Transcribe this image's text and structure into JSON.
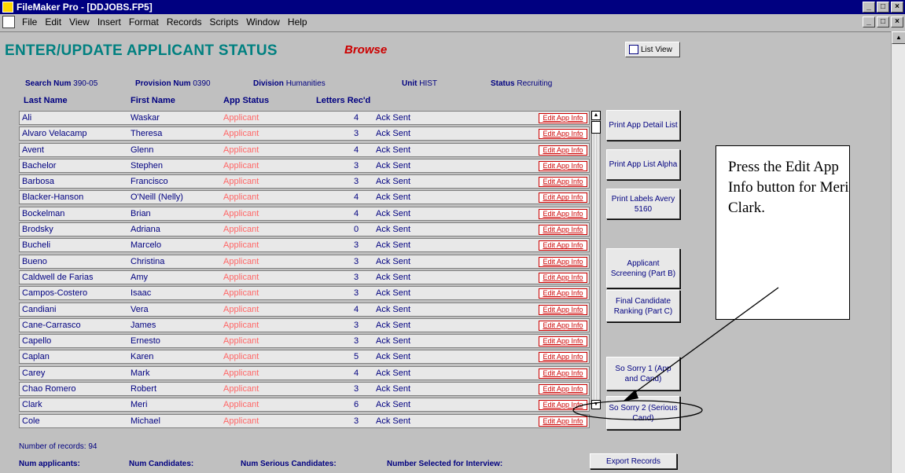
{
  "window": {
    "title": "FileMaker Pro - [DDJOBS.FP5]",
    "buttons": [
      "_",
      "□",
      "×"
    ]
  },
  "menu": [
    "File",
    "Edit",
    "View",
    "Insert",
    "Format",
    "Records",
    "Scripts",
    "Window",
    "Help"
  ],
  "header": {
    "title": "ENTER/UPDATE APPLICANT STATUS",
    "mode": "Browse",
    "list_view_label": "List View"
  },
  "info": {
    "search_label": "Search Num",
    "search_value": "390-05",
    "provision_label": "Provision Num",
    "provision_value": "0390",
    "division_label": "Division",
    "division_value": "Humanities",
    "unit_label": "Unit",
    "unit_value": "HIST",
    "status_label": "Status",
    "status_value": "Recruiting"
  },
  "columns": {
    "last": "Last Name",
    "first": "First Name",
    "status": "App Status",
    "letters": "Letters Rec'd"
  },
  "edit_label": "Edit App Info",
  "rows": [
    {
      "last": "Ali",
      "first": "Waskar",
      "status": "Applicant",
      "letters": "4",
      "ack": "Ack Sent"
    },
    {
      "last": "Alvaro Velacamp",
      "first": "Theresa",
      "status": "Applicant",
      "letters": "3",
      "ack": "Ack Sent"
    },
    {
      "last": "Avent",
      "first": "Glenn",
      "status": "Applicant",
      "letters": "4",
      "ack": "Ack Sent"
    },
    {
      "last": "Bachelor",
      "first": "Stephen",
      "status": "Applicant",
      "letters": "3",
      "ack": "Ack Sent"
    },
    {
      "last": "Barbosa",
      "first": "Francisco",
      "status": "Applicant",
      "letters": "3",
      "ack": "Ack Sent"
    },
    {
      "last": "Blacker-Hanson",
      "first": "O'Neill (Nelly)",
      "status": "Applicant",
      "letters": "4",
      "ack": "Ack Sent"
    },
    {
      "last": "Bockelman",
      "first": "Brian",
      "status": "Applicant",
      "letters": "4",
      "ack": "Ack Sent"
    },
    {
      "last": "Brodsky",
      "first": "Adriana",
      "status": "Applicant",
      "letters": "0",
      "ack": "Ack Sent"
    },
    {
      "last": "Bucheli",
      "first": "Marcelo",
      "status": "Applicant",
      "letters": "3",
      "ack": "Ack Sent"
    },
    {
      "last": "Bueno",
      "first": "Christina",
      "status": "Applicant",
      "letters": "3",
      "ack": "Ack Sent"
    },
    {
      "last": "Caldwell de Farias",
      "first": "Amy",
      "status": "Applicant",
      "letters": "3",
      "ack": "Ack Sent"
    },
    {
      "last": "Campos-Costero",
      "first": "Isaac",
      "status": "Applicant",
      "letters": "3",
      "ack": "Ack Sent"
    },
    {
      "last": "Candiani",
      "first": "Vera",
      "status": "Applicant",
      "letters": "4",
      "ack": "Ack Sent"
    },
    {
      "last": "Cane-Carrasco",
      "first": "James",
      "status": "Applicant",
      "letters": "3",
      "ack": "Ack Sent"
    },
    {
      "last": "Capello",
      "first": "Ernesto",
      "status": "Applicant",
      "letters": "3",
      "ack": "Ack Sent"
    },
    {
      "last": "Caplan",
      "first": "Karen",
      "status": "Applicant",
      "letters": "5",
      "ack": "Ack Sent"
    },
    {
      "last": "Carey",
      "first": "Mark",
      "status": "Applicant",
      "letters": "4",
      "ack": "Ack Sent"
    },
    {
      "last": "Chao Romero",
      "first": "Robert",
      "status": "Applicant",
      "letters": "3",
      "ack": "Ack Sent"
    },
    {
      "last": "Clark",
      "first": "Meri",
      "status": "Applicant",
      "letters": "6",
      "ack": "Ack Sent"
    },
    {
      "last": "Cole",
      "first": "Michael",
      "status": "Applicant",
      "letters": "3",
      "ack": "Ack Sent"
    }
  ],
  "side_buttons": {
    "print_detail": "Print App Detail List",
    "print_alpha": "Print App List Alpha",
    "print_labels": "Print Labels Avery 5160",
    "screening": "Applicant Screening (Part B)",
    "ranking": "Final Candidate Ranking (Part C)",
    "sorry1": "So Sorry 1 (App and Cand)",
    "sorry2": "So Sorry 2 (Serious Cand)"
  },
  "callout": "Press the Edit App Info button for Meri Clark.",
  "footer": {
    "records": "Number of records: 94",
    "num_applicants": "Num applicants:",
    "num_candidates": "Num Candidates:",
    "num_serious": "Num Serious Candidates:",
    "num_selected": "Number Selected for Interview:",
    "export": "Export Records"
  }
}
